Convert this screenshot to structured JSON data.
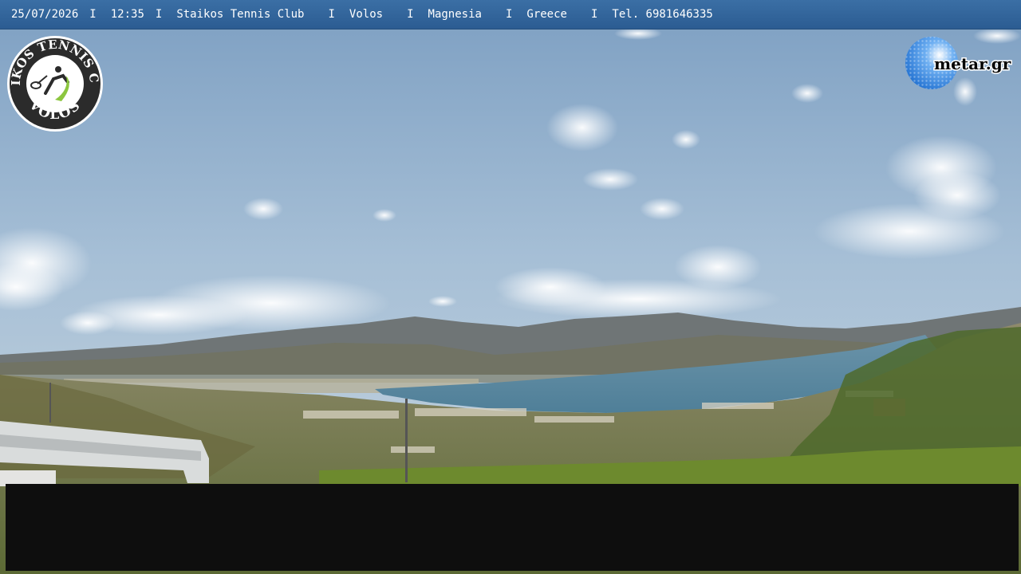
{
  "header": {
    "date": "25/07/2026",
    "time": "12:35",
    "club": "Staikos Tennis Club",
    "city": "Volos",
    "region": "Magnesia",
    "country": "Greece",
    "phone": "Tel. 6981646335",
    "separator": "I"
  },
  "club_logo": {
    "text_top": "STAIKOS TENNIS CLUB",
    "text_bottom": "VOLOS",
    "icon": "tennis-player-icon"
  },
  "metar_logo": {
    "text": "metar.gr",
    "icon": "golf-ball-globe-icon"
  },
  "colors": {
    "header_bg": "#2f6198",
    "sky_top": "#7fa3c6",
    "sea": "#5d8aa3",
    "mountains": "#6b6f70",
    "overlay_bar": "#0e0e0e"
  }
}
